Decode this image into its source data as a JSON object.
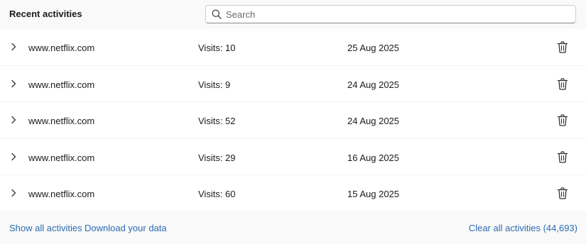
{
  "header": {
    "title": "Recent activities",
    "search": {
      "placeholder": "Search",
      "value": ""
    }
  },
  "activities": [
    {
      "site": "www.netflix.com",
      "visits": "Visits: 10",
      "date": "25 Aug 2025"
    },
    {
      "site": "www.netflix.com",
      "visits": "Visits: 9",
      "date": "24 Aug 2025"
    },
    {
      "site": "www.netflix.com",
      "visits": "Visits: 52",
      "date": "24 Aug 2025"
    },
    {
      "site": "www.netflix.com",
      "visits": "Visits: 29",
      "date": "16 Aug 2025"
    },
    {
      "site": "www.netflix.com",
      "visits": "Visits: 60",
      "date": "15 Aug 2025"
    }
  ],
  "footer": {
    "show_all": "Show all activities",
    "download": "Download your data",
    "clear_all": "Clear all activities (44,693)"
  },
  "icons": {
    "search": "search-icon",
    "expand": "chevron-right-icon",
    "delete": "trash-icon"
  },
  "colors": {
    "link": "#2b6cb0",
    "text": "#1b1b1b",
    "background": "#f9f9f9",
    "list_background": "#ffffff"
  }
}
